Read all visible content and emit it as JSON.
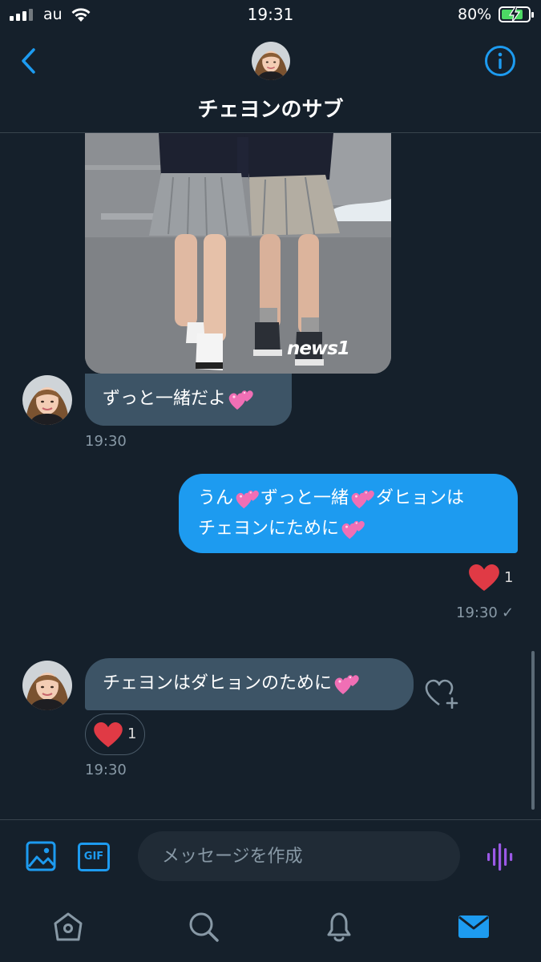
{
  "status_bar": {
    "carrier": "au",
    "time": "19:31",
    "battery_percent": "80%",
    "battery_level": 0.8,
    "icons": [
      "signal-icon",
      "wifi-icon",
      "battery-charging-icon"
    ]
  },
  "header": {
    "title": "チェヨンのサブ",
    "icons": [
      "back-arrow-icon",
      "avatar",
      "info-icon"
    ]
  },
  "messages": [
    {
      "direction": "incoming",
      "image": "photo",
      "text": "ずっと一緒だよ",
      "emoji": "heart-emoji",
      "time": "19:30"
    },
    {
      "direction": "outgoing",
      "line1_a": "うん",
      "line1_b": "ずっと一緒",
      "line1_c": "ダヒョンは",
      "line2": "チェヨンにために",
      "reaction_count": "1",
      "time": "19:30",
      "status": "✓"
    },
    {
      "direction": "incoming",
      "text": "チェヨンはダヒョンのために",
      "reaction_count": "1",
      "time": "19:30"
    }
  ],
  "photo": {
    "watermark": "news1"
  },
  "composer": {
    "gif_label": "GIF",
    "placeholder": "メッセージを作成",
    "icons": [
      "image-icon",
      "gif-icon",
      "voice-icon"
    ]
  },
  "tabs": [
    {
      "icon": "home-icon"
    },
    {
      "icon": "search-icon"
    },
    {
      "icon": "bell-icon"
    },
    {
      "icon": "mail-icon"
    }
  ],
  "colors": {
    "background": "#15202b",
    "accent": "#1d9bf0",
    "incoming_bubble": "#3d5466",
    "heart_red": "#e0245e",
    "voice_purple": "#9b59e6"
  }
}
